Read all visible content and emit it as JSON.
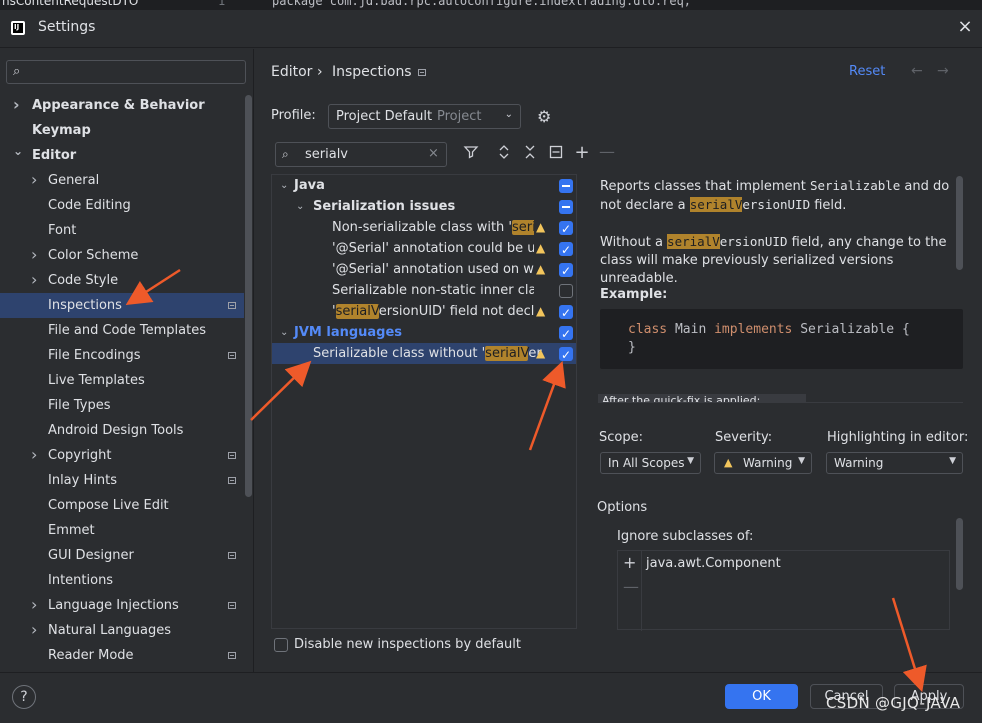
{
  "editor_strip": {
    "tab_text": "nsContentRequestDTO",
    "line_number": "1",
    "code": "package com.jd.bad.rpc.autoconfigure.indextrading.dto.req;"
  },
  "window": {
    "title": "Settings",
    "close_icon": "close-icon"
  },
  "sidebar": {
    "search_placeholder": "",
    "items": [
      {
        "label": "Appearance & Behavior",
        "bold": true,
        "expandable": true,
        "expanded": false
      },
      {
        "label": "Keymap",
        "bold": true
      },
      {
        "label": "Editor",
        "bold": true,
        "expandable": true,
        "expanded": true
      },
      {
        "label": "General",
        "expandable": true
      },
      {
        "label": "Code Editing"
      },
      {
        "label": "Font"
      },
      {
        "label": "Color Scheme",
        "expandable": true
      },
      {
        "label": "Code Style",
        "expandable": true
      },
      {
        "label": "Inspections",
        "selected": true,
        "config_icon": true
      },
      {
        "label": "File and Code Templates"
      },
      {
        "label": "File Encodings",
        "config_icon": true
      },
      {
        "label": "Live Templates"
      },
      {
        "label": "File Types"
      },
      {
        "label": "Android Design Tools"
      },
      {
        "label": "Copyright",
        "expandable": true,
        "config_icon": true
      },
      {
        "label": "Inlay Hints",
        "config_icon": true
      },
      {
        "label": "Compose Live Edit"
      },
      {
        "label": "Emmet"
      },
      {
        "label": "GUI Designer",
        "config_icon": true
      },
      {
        "label": "Intentions"
      },
      {
        "label": "Language Injections",
        "expandable": true,
        "config_icon": true
      },
      {
        "label": "Natural Languages",
        "expandable": true
      },
      {
        "label": "Reader Mode",
        "config_icon": true
      }
    ]
  },
  "header": {
    "breadcrumb_editor": "Editor",
    "breadcrumb_sep": "›",
    "breadcrumb_inspections": "Inspections",
    "reset_label": "Reset",
    "back_arrow": "←",
    "forward_arrow": "→"
  },
  "profile": {
    "label": "Profile:",
    "value": "Project Default",
    "scope_hint": "Project"
  },
  "filter": {
    "value": "serialv",
    "clear_icon": "×"
  },
  "tree": {
    "java": "Java",
    "serialization_issues": "Serialization issues",
    "items": [
      {
        "pre": "Non-serializable class with '",
        "hl": "seria",
        "post": "",
        "warn": true,
        "checked": "on"
      },
      {
        "pre": "'@Serial' annotation could be us",
        "hl": "",
        "post": "",
        "warn": true,
        "checked": "on"
      },
      {
        "pre": "'@Serial' annotation used on wr",
        "hl": "",
        "post": "",
        "warn": true,
        "checked": "on"
      },
      {
        "pre": "Serializable non-static inner clas",
        "hl": "",
        "post": "",
        "warn": false,
        "checked": "off"
      },
      {
        "pre": "'",
        "hl": "serialV",
        "post": "ersionUID' field not decla",
        "warn": true,
        "checked": "on"
      }
    ],
    "jvm_languages": "JVM languages",
    "jvm_item": {
      "pre": "Serializable class without '",
      "hl": "serialV",
      "post": "er"
    }
  },
  "disable_new": {
    "label": "Disable new inspections by default"
  },
  "description": {
    "p1_a": "Reports classes that implement ",
    "p1_code": "Serializable",
    "p1_b": " and do not declare a ",
    "p1_hl": "serialV",
    "p1_code2": "ersionUID",
    "p1_c": " field.",
    "p2_a": "Without a ",
    "p2_hl": "serialV",
    "p2_code": "ersionUID",
    "p2_b": " field, any change to the class will make previously serialized versions unreadable.",
    "example_label": "Example:",
    "code_kw1": "class",
    "code_name": " Main ",
    "code_kw2": "implements",
    "code_rest": " Serializable {",
    "code_close": "}",
    "cut_text": "After the quick-fix is applied:"
  },
  "scope": {
    "label": "Scope:",
    "value": "In All Scopes"
  },
  "severity": {
    "label": "Severity:",
    "value": "Warning"
  },
  "highlighting": {
    "label": "Highlighting in editor:",
    "value": "Warning"
  },
  "options": {
    "label": "Options",
    "ignore_label": "Ignore subclasses of:",
    "list_items": [
      "java.awt.Component"
    ],
    "plus": "+",
    "minus": "—"
  },
  "buttons": {
    "help": "?",
    "ok": "OK",
    "cancel": "Cancel",
    "apply": "Apply"
  },
  "watermark": "CSDN @GJQ-JAVA",
  "colors": {
    "accent": "#3574f0",
    "selection": "#2e436e",
    "highlight": "#b0832c",
    "annotation_arrow": "#ee5a2a"
  }
}
